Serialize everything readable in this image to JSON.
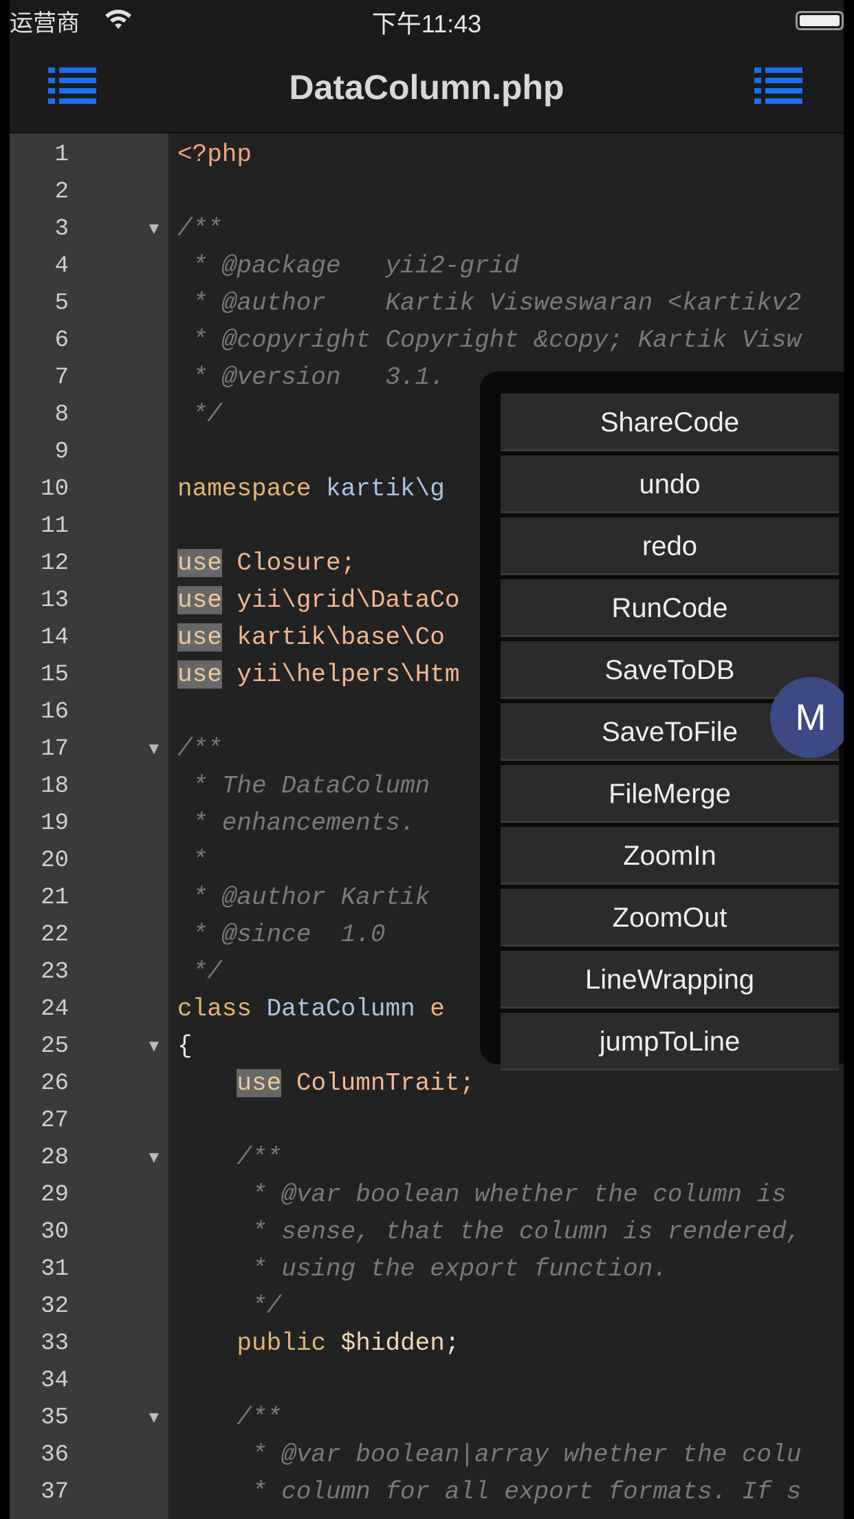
{
  "status_bar": {
    "carrier": "运营商",
    "time": "下午11:43"
  },
  "nav": {
    "title": "DataColumn.php",
    "left_icon": "list-icon",
    "right_icon": "list-icon"
  },
  "editor": {
    "line_numbers": [
      "1",
      "2",
      "3",
      "4",
      "5",
      "6",
      "7",
      "8",
      "9",
      "10",
      "11",
      "12",
      "13",
      "14",
      "15",
      "16",
      "17",
      "18",
      "19",
      "20",
      "21",
      "22",
      "23",
      "24",
      "25",
      "26",
      "27",
      "28",
      "29",
      "30",
      "31",
      "32",
      "33",
      "34",
      "35",
      "36",
      "37"
    ],
    "folded_lines": [
      3,
      17,
      25,
      28,
      35
    ],
    "code": {
      "l1": "<?php",
      "l3": "/**",
      "l4": " * @package   yii2-grid",
      "l5": " * @author    Kartik Visweswaran <kartikv2",
      "l6": " * @copyright Copyright &copy; Kartik Visw",
      "l7": " * @version   3.1.",
      "l8": " */",
      "l10_kw": "namespace",
      "l10_ns": " kartik\\g",
      "l12_use": "use",
      "l12_rest": " Closure;",
      "l13_use": "use",
      "l13_rest": " yii\\grid\\DataCo",
      "l14_use": "use",
      "l14_rest": " kartik\\base\\Co",
      "l15_use": "use",
      "l15_rest": " yii\\helpers\\Htm",
      "l17": "/**",
      "l18": " * The DataColumn",
      "l19": " * enhancements.",
      "l20": " *",
      "l21": " * @author Kartik",
      "l22": " * @since  1.0",
      "l23": " */",
      "l24_kw": "class",
      "l24_rest": " DataColumn ",
      "l24_tail": "e",
      "l25": "{",
      "l26_indent": "    ",
      "l26_use": "use",
      "l26_rest": " ColumnTrait;",
      "l28": "    /**",
      "l29": "     * @var boolean whether the column is",
      "l30": "     * sense, that the column is rendered,",
      "l31": "     * using the export function.",
      "l32": "     */",
      "l33_indent": "    ",
      "l33_kw": "public",
      "l33_var": " $hidden",
      "l33_end": ";",
      "l35": "    /**",
      "l36": "     * @var boolean|array whether the colu",
      "l37": "     * column for all export formats. If s"
    }
  },
  "menu": {
    "items": [
      "ShareCode",
      "undo",
      "redo",
      "RunCode",
      "SaveToDB",
      "SaveToFile",
      "FileMerge",
      "ZoomIn",
      "ZoomOut",
      "LineWrapping",
      "jumpToLine"
    ]
  },
  "fab": {
    "label": "M",
    "color": "#3b4a84"
  },
  "colors": {
    "keyword": "#e5b56d",
    "comment": "#7a7a7a",
    "namespace": "#a8c4e6",
    "accent_icon": "#1a6ef5"
  }
}
